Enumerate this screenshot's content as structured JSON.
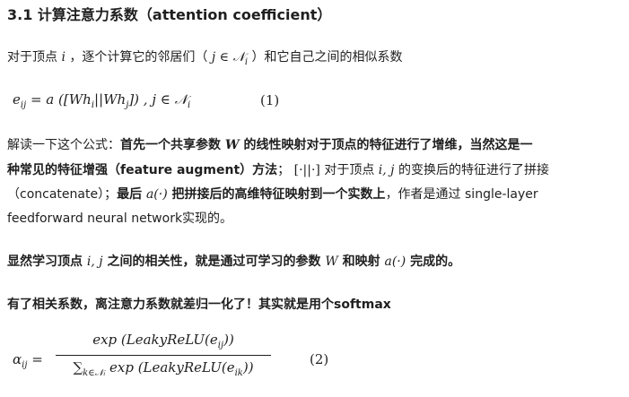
{
  "heading": "3.1 计算注意力系数（attention coefficient）",
  "intro": {
    "pre": "对于顶点 ",
    "var_i": "i",
    "mid": " ，逐个计算它的邻居们（ ",
    "neighbor": "j ∈ 𝒩",
    "neighbor_sub": "i",
    "post": " ）和它自己之间的相似系数"
  },
  "eq1": {
    "lhs": "e",
    "lhs_sub": "ij",
    "body_a": " = a ([Wh",
    "sub_i": "i",
    "body_b": "||Wh",
    "sub_j": "j",
    "body_c": "]) , j ∈ 𝒩",
    "tail_sub": "i",
    "tag": "(1)"
  },
  "explain": {
    "p1": "解读一下这个公式：",
    "b1": "首先一个共享参数 ",
    "W": "W",
    "b2": " 的线性映射对于顶点的特征进行了增维，当然这是一",
    "b3": "种常见的特征增强（feature augment）方法",
    "p2": "； ",
    "concat_sym": "[·||·]",
    "p3": " 对于顶点 ",
    "ij": "i, j",
    "p4": " 的变换后的特征进行了拼接",
    "p5": "（concatenate）；",
    "b4": "最后 ",
    "a_dot": "a(·)",
    "b5": " 把拼接后的高维特征映射到一个实数上",
    "p6": "，作者是通过 single-layer",
    "p7": "feedforward neural network实现的。"
  },
  "correlation": {
    "t1": "显然学习顶点 ",
    "ij": "i, j",
    "t2": " 之间的相关性，就是通过可学习的参数 ",
    "W": "W",
    "t3": " 和映射 ",
    "a_dot": "a(·)",
    "t4": " 完成的。"
  },
  "softmax_line": "有了相关系数，离注意力系数就差归一化了！其实就是用个softmax",
  "eq2": {
    "lhs": "α",
    "lhs_sub": "ij",
    "num": "exp (LeakyReLU(e",
    "num_sub": "ij",
    "num_end": "))",
    "den_sum": "∑",
    "den_sub": "k∈𝒩ᵢ",
    "den": " exp (LeakyReLU(e",
    "den_sub2": "ik",
    "den_end": "))",
    "tag": "(2)"
  }
}
